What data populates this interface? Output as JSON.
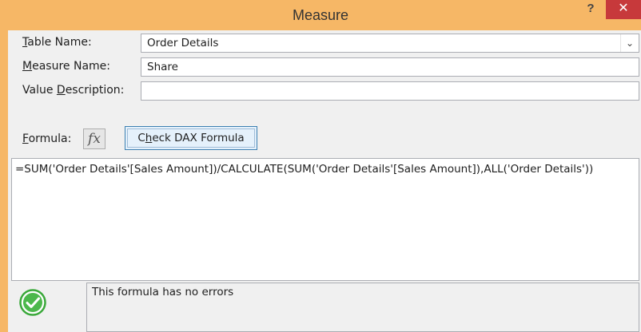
{
  "window": {
    "title": "Measure",
    "help_label": "?",
    "close_label": "✕"
  },
  "form": {
    "table_name_label_mnemonic": "T",
    "table_name_label_rest": "able Name:",
    "table_name_value": "Order Details",
    "measure_name_label_mnemonic": "M",
    "measure_name_label_rest": "easure Name:",
    "measure_name_value": "Share",
    "value_description_label_pre": "Value ",
    "value_description_label_mnemonic": "D",
    "value_description_label_rest": "escription:",
    "value_description_value": "",
    "formula_label_mnemonic": "F",
    "formula_label_rest": "ormula:",
    "fx_label": "fx",
    "check_button_pre": "C",
    "check_button_mnemonic": "h",
    "check_button_rest": "eck DAX Formula"
  },
  "formula": {
    "text": "=SUM('Order Details'[Sales Amount])/CALCULATE(SUM('Order Details'[Sales Amount]),ALL('Order Details'))"
  },
  "status": {
    "message": "This formula has no errors",
    "icon": "check-circle-icon",
    "icon_color": "#3aa83a"
  },
  "colors": {
    "frame": "#f6b766",
    "close": "#c7393b"
  }
}
